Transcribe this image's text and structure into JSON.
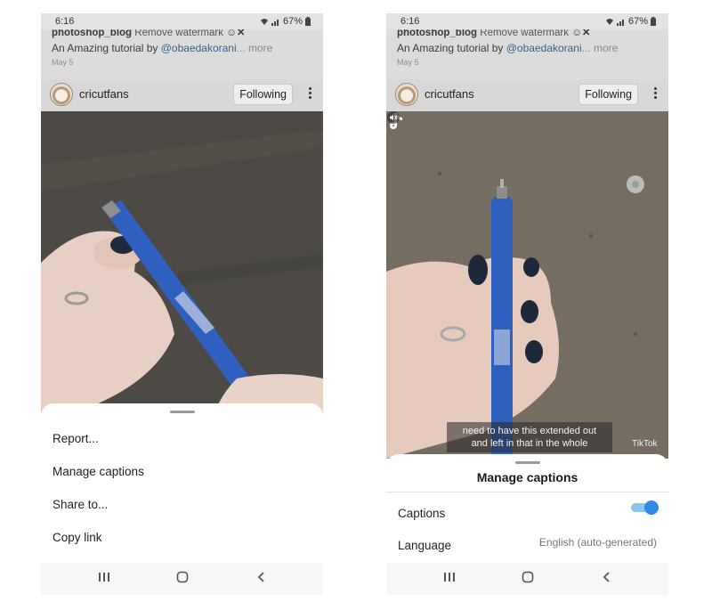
{
  "left_screen": {
    "status": {
      "time": "6:16",
      "battery": "67%"
    },
    "post": {
      "prev_username": "photoshop_blog",
      "prev_title": "Remove watermark",
      "prev_caption": "An Amazing tutorial by ",
      "prev_handle": "@obaedakorani",
      "prev_more": "... more",
      "prev_date": "May 5"
    },
    "profile": {
      "username": "cricutfans",
      "follow_label": "Following"
    },
    "menu": {
      "items": [
        "Report...",
        "Manage captions",
        "Share to...",
        "Copy link"
      ]
    }
  },
  "right_screen": {
    "status": {
      "time": "6:16",
      "battery": "67%"
    },
    "post": {
      "prev_username": "photoshop_blog",
      "prev_title": "Remove watermark",
      "prev_caption": "An Amazing tutorial by ",
      "prev_handle": "@obaedakorani",
      "prev_more": "... more",
      "prev_date": "May 5"
    },
    "profile": {
      "username": "cricutfans",
      "follow_label": "Following"
    },
    "video": {
      "subtitle_line1": "need to have this extended out",
      "subtitle_line2": "and left in that in the whole",
      "watermark": "TikTok"
    },
    "captions_sheet": {
      "title": "Manage captions",
      "captions_label": "Captions",
      "captions_enabled": true,
      "language_label": "Language",
      "language_value": "English (auto-generated)"
    }
  },
  "colors": {
    "accent": "#2e8ae6",
    "toggle_track": "#8fc3ef"
  },
  "icons": [
    "kebab-menu-icon",
    "recent-apps-icon",
    "home-icon",
    "back-icon",
    "tiktok-logo-icon",
    "mute-icon",
    "wifi-icon",
    "signal-icon",
    "battery-icon"
  ]
}
